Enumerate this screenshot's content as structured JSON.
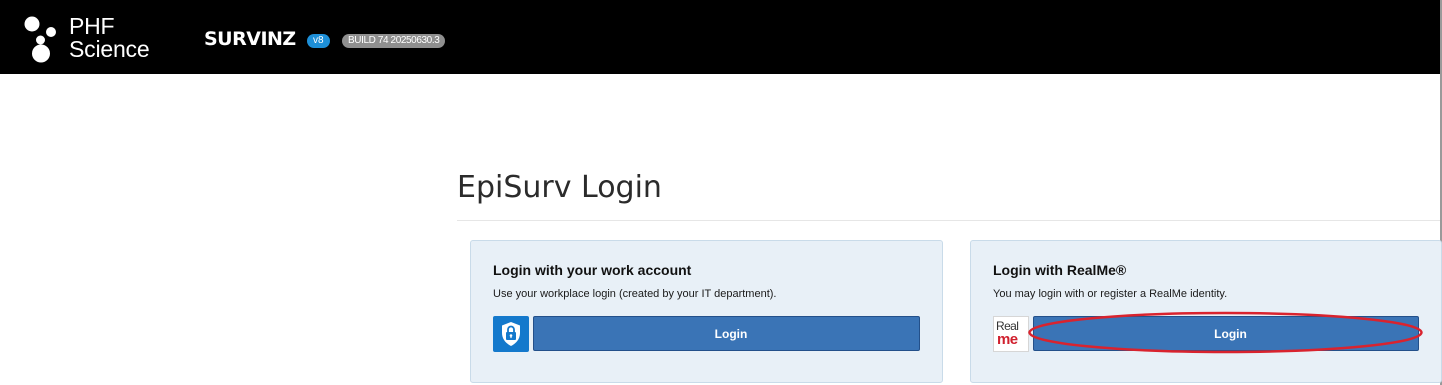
{
  "header": {
    "logo_line1": "PHF",
    "logo_line2": "Science",
    "app_name": "SURVINZ",
    "version_badge": "v8",
    "build_badge": "BUILD 74 20250630.3"
  },
  "page": {
    "title": "EpiSurv Login"
  },
  "work_account": {
    "heading": "Login with your work account",
    "description": "Use your workplace login (created by your IT department).",
    "button_label": "Login",
    "icon": "lock-shield-icon"
  },
  "realme": {
    "heading": "Login with RealMe®",
    "description": "You may login with or register a RealMe identity.",
    "button_label": "Login",
    "logo_line1": "Real",
    "logo_line2": "me",
    "icon": "realme-logo"
  },
  "annotation": {
    "highlight_color": "#d9232e"
  },
  "colors": {
    "topbar": "#000000",
    "accent_blue": "#3a74b6",
    "version_blue": "#1d8fd8",
    "card_bg": "#e8f0f7"
  }
}
